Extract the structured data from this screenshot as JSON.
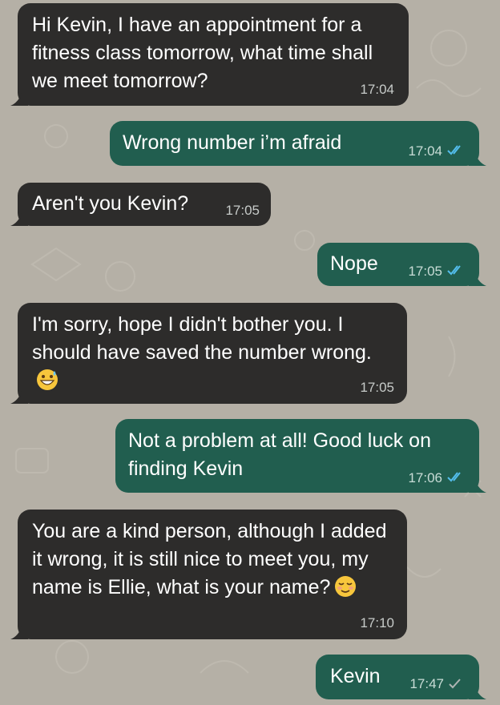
{
  "chat": {
    "messages": [
      {
        "direction": "in",
        "text": "Hi Kevin, I have an appointment for a fitness class tomorrow, what time shall we meet tomorrow?",
        "time": "17:04"
      },
      {
        "direction": "out",
        "text": "Wrong number i’m afraid",
        "time": "17:04",
        "status": "read"
      },
      {
        "direction": "in",
        "text": "Aren't you Kevin?",
        "time": "17:05"
      },
      {
        "direction": "out",
        "text": "Nope",
        "time": "17:05",
        "status": "read"
      },
      {
        "direction": "in",
        "text": "I'm sorry, hope I didn't bother you. I should have saved the number wrong.",
        "emoji": "grinning-face-with-sweat",
        "time": "17:05"
      },
      {
        "direction": "out",
        "text": "Not a problem at all! Good luck on finding Kevin",
        "time": "17:06",
        "status": "read"
      },
      {
        "direction": "in",
        "text": "You are a kind person, although I added it wrong, it is still nice to meet you, my name is Ellie, what is your name?",
        "emoji": "relieved-face",
        "time": "17:10"
      },
      {
        "direction": "out",
        "text": "Kevin",
        "time": "17:47",
        "status": "sent"
      }
    ]
  },
  "colors": {
    "background": "#b5b0a6",
    "incoming_bubble": "#2d2c2b",
    "outgoing_bubble": "#215e4f",
    "read_ticks": "#53bdeb",
    "sent_tick": "#aeb5b3"
  }
}
